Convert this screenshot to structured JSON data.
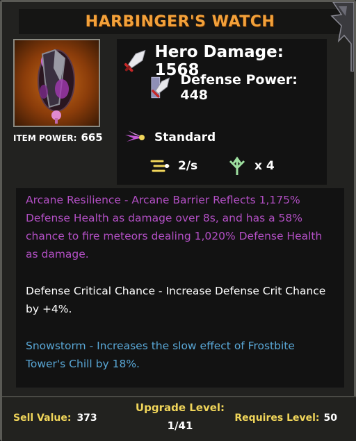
{
  "title": "HARBINGER'S WATCH",
  "item": {
    "power_label": "ITEM POWER:",
    "power_value": "665",
    "icon": "harbinger-watch-icon"
  },
  "stats": {
    "hero_damage": "Hero Damage: 1568",
    "defense_power": "Defense Power: 448",
    "attack_type": "Standard",
    "attack_speed": "2/s",
    "shots": "x 4"
  },
  "descriptions": [
    "Arcane Resilience - Arcane Barrier Reflects 1,175% Defense Health as damage over 8s, and has a 58% chance to fire meteors dealing 1,020% Defense Health as damage.",
    "Defense Critical Chance - Increase Defense Crit Chance by +4%.",
    "Snowstorm - Increases the slow effect of Frostbite Tower's Chill by 18%."
  ],
  "footer": {
    "sell_label": "Sell Value:",
    "sell_value": "373",
    "upgrade_label": "Upgrade Level:",
    "upgrade_value": "1/41",
    "requires_label": "Requires Level:",
    "requires_value": "50"
  },
  "colors": {
    "title": "#f3a13a",
    "arcane": "#b24fc4",
    "crit": "#ffffff",
    "snow": "#59a7d6",
    "footer_label": "#f0d55a"
  }
}
